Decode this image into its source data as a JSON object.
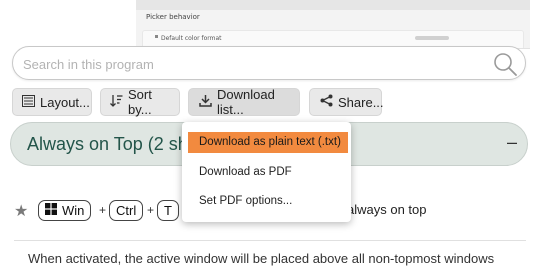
{
  "embedded_screenshot": {
    "header": "Picker behavior",
    "row_label": "Default color format"
  },
  "search": {
    "placeholder": "Search in this program"
  },
  "toolbar": {
    "layout_label": "Layout...",
    "sort_label": "Sort by...",
    "download_label": "Download list...",
    "share_label": "Share..."
  },
  "section": {
    "title": "Always on Top (2 sho"
  },
  "download_menu": {
    "items": [
      "Download as plain text (.txt)",
      "Download as PDF",
      "Set PDF options..."
    ],
    "highlight_color": "#f28a3f"
  },
  "shortcut": {
    "keys": [
      "Win",
      "Ctrl",
      "T"
    ],
    "description": "always on top"
  },
  "description_text": "When activated, the active window will be placed above all non-topmost windows"
}
